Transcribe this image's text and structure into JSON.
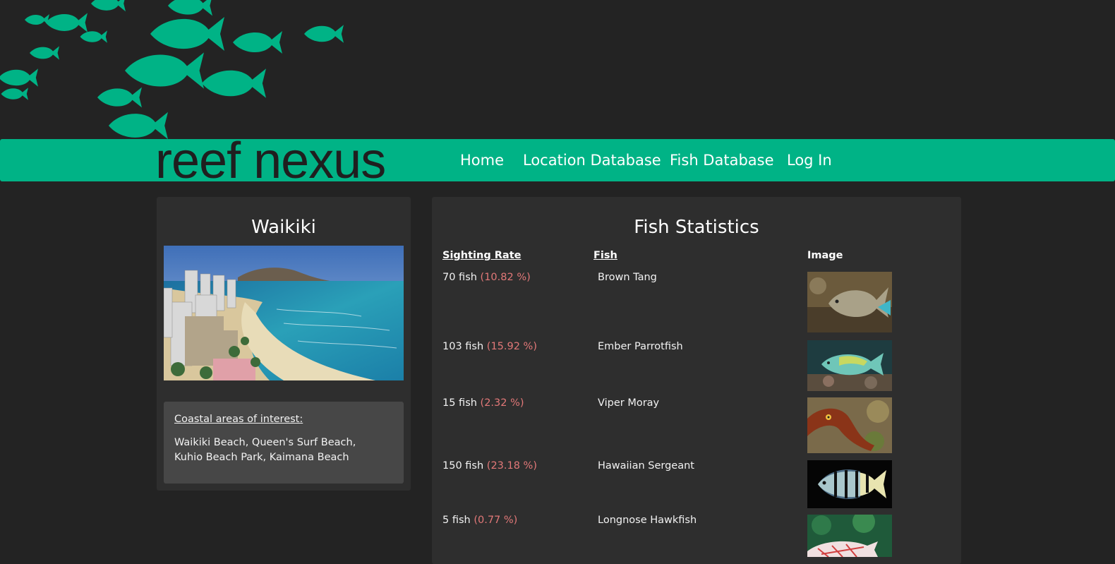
{
  "brand": {
    "logo_text": "reef nexus",
    "accent_color": "#00b386",
    "background_color": "#232323"
  },
  "nav": {
    "items": [
      {
        "label": "Home"
      },
      {
        "label": "Location Database"
      },
      {
        "label": "Fish Database"
      },
      {
        "label": "Log In"
      }
    ]
  },
  "location": {
    "name": "Waikiki",
    "photo": "waikiki-beach-photo",
    "poi_heading": "Coastal areas of interest:",
    "poi_text": "Waikiki Beach, Queen's Surf Beach, Kuhio Beach Park, Kaimana Beach"
  },
  "stats": {
    "title": "Fish Statistics",
    "columns": {
      "rate": "Sighting Rate",
      "fish": "Fish",
      "image": "Image"
    },
    "percent_color": "#e27878",
    "rows": [
      {
        "count": "70 fish",
        "pct": "(10.82 %)",
        "fish": "Brown Tang",
        "image": "brown-tang-photo"
      },
      {
        "count": "103 fish",
        "pct": "(15.92 %)",
        "fish": "Ember Parrotfish",
        "image": "ember-parrotfish-photo"
      },
      {
        "count": "15 fish",
        "pct": "(2.32 %)",
        "fish": "Viper Moray",
        "image": "viper-moray-photo"
      },
      {
        "count": "150 fish",
        "pct": "(23.18 %)",
        "fish": "Hawaiian Sergeant",
        "image": "hawaiian-sergeant-photo"
      },
      {
        "count": "5 fish",
        "pct": "(0.77 %)",
        "fish": "Longnose Hawkfish",
        "image": "longnose-hawkfish-photo"
      }
    ]
  }
}
